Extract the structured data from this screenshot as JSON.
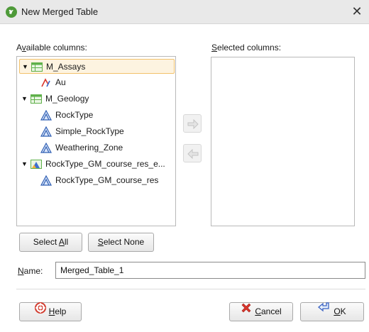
{
  "window": {
    "title": "New Merged Table",
    "close_glyph": "✕"
  },
  "available": {
    "label_pre": "A",
    "label_u": "v",
    "label_post": "ailable columns:",
    "items": [
      {
        "label": "M_Assays",
        "icon": "table-icon",
        "expanded": true,
        "selected": true
      },
      {
        "label": "Au",
        "icon": "numeric-column-icon"
      },
      {
        "label": "M_Geology",
        "icon": "table-icon",
        "expanded": true
      },
      {
        "label": "RockType",
        "icon": "category-column-icon"
      },
      {
        "label": "Simple_RockType",
        "icon": "category-column-icon"
      },
      {
        "label": "Weathering_Zone",
        "icon": "category-column-icon"
      },
      {
        "label": "RockType_GM_course_res_e...",
        "icon": "geomodel-table-icon",
        "expanded": true
      },
      {
        "label": "RockType_GM_course_res",
        "icon": "category-column-icon"
      }
    ]
  },
  "selected": {
    "label_u": "S",
    "label_post": "elected columns:",
    "items": []
  },
  "buttons": {
    "select_all_pre": "Select ",
    "select_all_u": "A",
    "select_all_post": "ll",
    "select_none_u": "S",
    "select_none_post": "elect None",
    "help_u": "H",
    "help_post": "elp",
    "cancel_u": "C",
    "cancel_post": "ancel",
    "ok_u": "O",
    "ok_post": "K"
  },
  "name_field": {
    "label_u": "N",
    "label_post": "ame:",
    "value": "Merged_Table_1"
  },
  "colors": {
    "table_icon": "#5fb04a",
    "category_icon": "#2f5fb3",
    "numeric_icon_a": "#d9352b",
    "numeric_icon_b": "#3b63c4",
    "selected_row_bg": "#fdf3e0",
    "selected_row_border": "#f2c26b"
  }
}
